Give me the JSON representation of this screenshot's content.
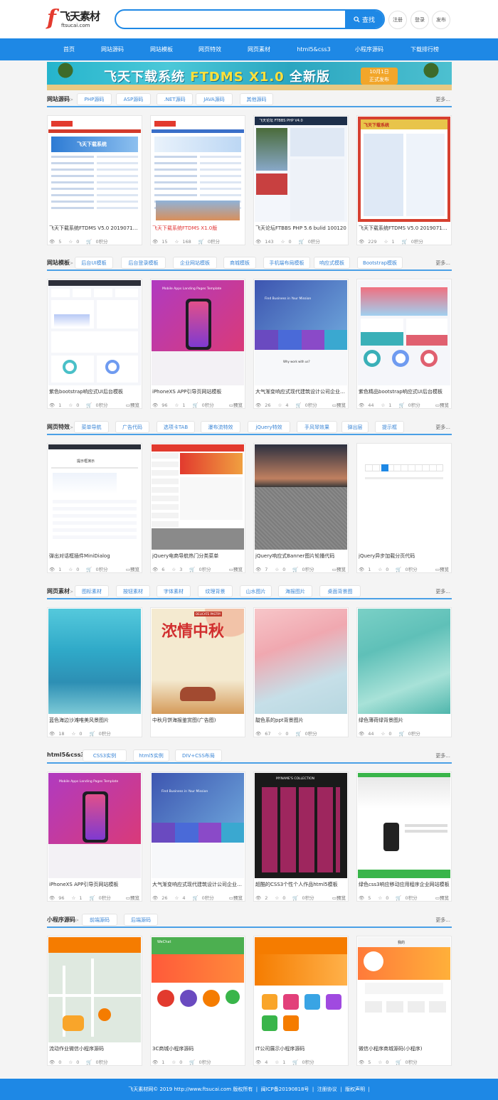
{
  "header": {
    "logo_mark": "f",
    "logo_text": "飞天素材",
    "logo_url": "ftsucai.com",
    "search_placeholder": "",
    "search_button": "查找",
    "register": "注册",
    "login": "登录",
    "publish": "发布"
  },
  "nav": [
    "首页",
    "网站源码",
    "网站模板",
    "网页特效",
    "网页素材",
    "html5&css3",
    "小程序源码",
    "下载排行榜"
  ],
  "banner": {
    "headline_a": "飞天下载系统 ",
    "headline_b": "FTDMS X1.0",
    "headline_c": " 全新版",
    "badge_line1": "10月1日",
    "badge_line2": "正式发布"
  },
  "more_label": "更多...",
  "arrow": ">",
  "stat_icons": {
    "view": "👁",
    "star": "☆",
    "cart": "🛒"
  },
  "preview_label": "预览",
  "sections": [
    {
      "title": "网站源码",
      "tags": [
        "PHP源码",
        "ASP源码",
        ".NET源码",
        "JAVA源码",
        "其他源码"
      ],
      "cards": [
        {
          "title": "飞天下载系统FTDMS V5.0 20190713(...",
          "views": "5",
          "stars": "0",
          "price": "0积分",
          "preview": false,
          "hot": false
        },
        {
          "title": "飞天下载系统FTDMS X1.0版",
          "views": "15",
          "stars": "168",
          "price": "0积分",
          "preview": false,
          "hot": true
        },
        {
          "title": "飞天论坛FTBBS PHP 5.6 bulid 100120",
          "views": "143",
          "stars": "0",
          "price": "0积分",
          "preview": false,
          "hot": false
        },
        {
          "title": "飞天下载系统FTDMS V5.0 20190713(...",
          "views": "229",
          "stars": "1",
          "price": "0积分",
          "preview": false,
          "hot": false
        }
      ]
    },
    {
      "title": "网站模板",
      "tags": [
        "后台UI模板",
        "后台登录模板",
        "企业网站模板",
        "商城模板",
        "手机端布局模板",
        "响应式模板",
        "Bootstrap模板"
      ],
      "cards": [
        {
          "title": "紫色bootstrap响应式UI后台模板",
          "views": "1",
          "stars": "0",
          "price": "0积分",
          "preview": true
        },
        {
          "title": "iPhoneXS APP引导页网站模板",
          "views": "96",
          "stars": "1",
          "price": "0积分",
          "preview": true
        },
        {
          "title": "大气渐变响应式现代建筑设计公司企业模...",
          "views": "26",
          "stars": "4",
          "price": "0积分",
          "preview": true
        },
        {
          "title": "紫色精品bootstrap响应式UI后台模板",
          "views": "44",
          "stars": "1",
          "price": "0积分",
          "preview": true
        }
      ]
    },
    {
      "title": "网页特效",
      "tags": [
        "菜单导航",
        "广告代码",
        "选项卡TAB",
        "瀑布流特效",
        "jQuery特效",
        "手风琴效果",
        "弹出层",
        "提示框"
      ],
      "cards": [
        {
          "title": "弹出对话框插件MiniDialog",
          "views": "1",
          "stars": "0",
          "price": "0积分",
          "preview": true
        },
        {
          "title": "jQuery电商导航热门分类菜单",
          "views": "6",
          "stars": "3",
          "price": "0积分",
          "preview": true
        },
        {
          "title": "jQuery响应式Banner图片轮播代码",
          "views": "7",
          "stars": "0",
          "price": "0积分",
          "preview": true
        },
        {
          "title": "jQuery异步加载分页代码",
          "views": "1",
          "stars": "0",
          "price": "0积分",
          "preview": true
        }
      ]
    },
    {
      "title": "网页素材",
      "tags": [
        "图标素材",
        "按钮素材",
        "字体素材",
        "纹理背景",
        "山水图片",
        "海报图片",
        "桌面背景图"
      ],
      "cards": [
        {
          "title": "蓝色海边沙滩唯美风景图片",
          "views": "18",
          "stars": "0",
          "price": "0积分",
          "preview": false
        },
        {
          "title": "中秋月饼海报鉴赏图(广告图)",
          "views": "",
          "stars": "",
          "price": "",
          "preview": false
        },
        {
          "title": "靛色系的ppt背景图片",
          "views": "67",
          "stars": "0",
          "price": "0积分",
          "preview": false
        },
        {
          "title": "绿色薄荷绿背景图片",
          "views": "44",
          "stars": "0",
          "price": "0积分",
          "preview": false
        }
      ]
    },
    {
      "title": "html5&css3",
      "tags": [
        "CSS3实例",
        "html5实例",
        "DIV+CSS布局"
      ],
      "cards": [
        {
          "title": "iPhoneXS APP引导页网站模板",
          "views": "96",
          "stars": "1",
          "price": "0积分",
          "preview": true
        },
        {
          "title": "大气渐变响应式现代建筑设计公司企业模...",
          "views": "26",
          "stars": "4",
          "price": "0积分",
          "preview": true
        },
        {
          "title": "超酷的CSS3个性个人作品html5模板",
          "views": "2",
          "stars": "0",
          "price": "0积分",
          "preview": true
        },
        {
          "title": "绿色css3响应移动应用程序企业网站模板",
          "views": "5",
          "stars": "0",
          "price": "0积分",
          "preview": true
        }
      ]
    },
    {
      "title": "小程序源码",
      "tags": [
        "前端源码",
        "后端源码"
      ],
      "cards": [
        {
          "title": "流动作业微信小程序源码",
          "views": "0",
          "stars": "0",
          "price": "0积分",
          "preview": false
        },
        {
          "title": "3C商城小程序源码",
          "views": "1",
          "stars": "0",
          "price": "0积分",
          "preview": false
        },
        {
          "title": "IT公司展示小程序源码",
          "views": "4",
          "stars": "1",
          "price": "0积分",
          "preview": false
        },
        {
          "title": "微信小程序商城源码(小程序)",
          "views": "5",
          "stars": "0",
          "price": "0积分",
          "preview": false
        }
      ]
    }
  ],
  "thumb_texts": {
    "t1": "飞天下载系统",
    "t2": "飞天下载",
    "t3": "飞天论坛 FTBBS PHP V4.0",
    "t4": "飞天下载系统",
    "t5": "Mobile Apps Landing Pages Template",
    "t6": "Find Business in Your Mission",
    "t7": "Mobile Apps Landing Pages Template",
    "t8": "Find Business in Your Mission",
    "t9": "浓情中秋",
    "t10": "DELICATE PASTRY",
    "t11": "WeChat",
    "t12": "我的",
    "t13": "Why work with us?",
    "t14": "提示框演示",
    "t15": "MYNAME'S COLLECTION"
  },
  "footer": {
    "copyright": "飞天素材网© 2019 http://www.ftsucai.com 版权所有",
    "sep1": "|",
    "icp": "闽ICP备20190818号",
    "sep2": "|",
    "agreement": "注册协议",
    "sep3": "|",
    "statement": "版权声明",
    "sep4": "|"
  },
  "colors": {
    "primary": "#1e88e5",
    "hot": "#e03030",
    "link": "#3b86d6"
  }
}
